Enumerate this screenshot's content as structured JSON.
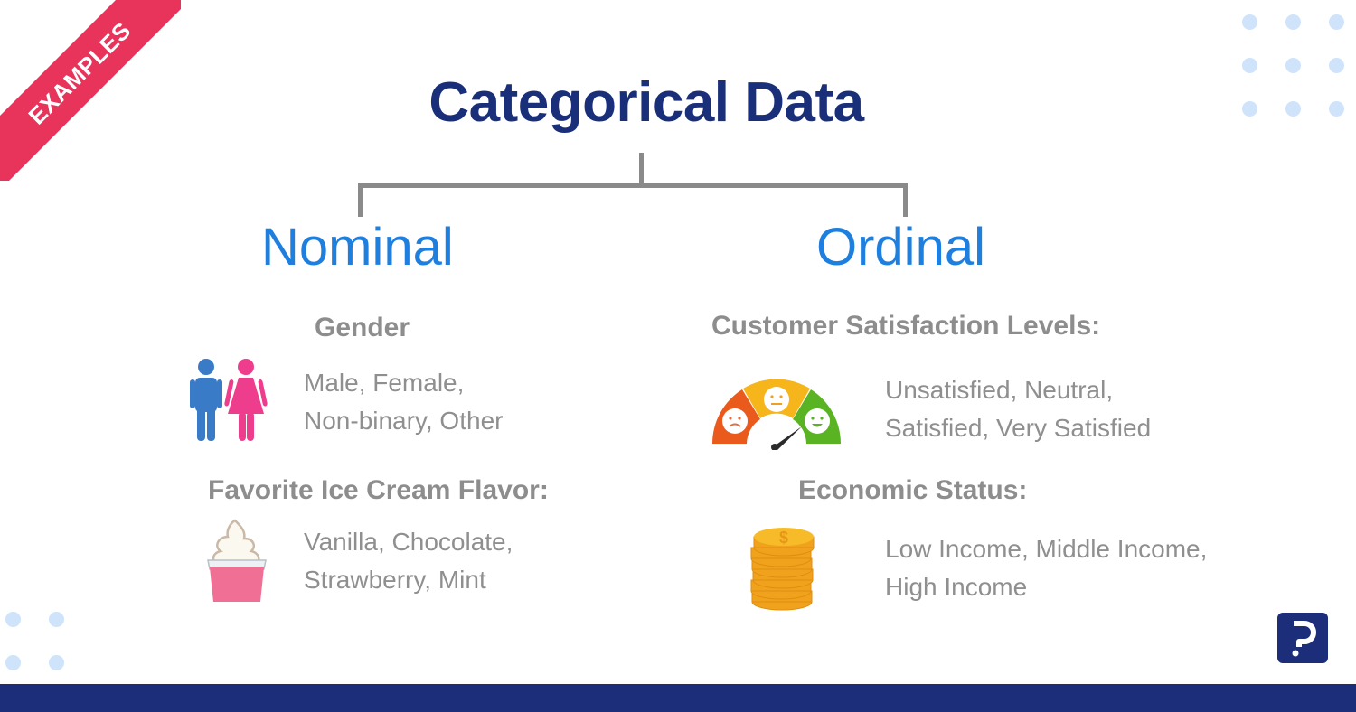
{
  "ribbon": {
    "label": "EXAMPLES",
    "color": "#e8335a"
  },
  "title": "Categorical Data",
  "branches": [
    {
      "label": "Nominal",
      "examples": [
        {
          "heading": "Gender",
          "icon": "male-female-icon",
          "values": [
            "Male, Female,",
            "Non-binary, Other"
          ]
        },
        {
          "heading": "Favorite Ice Cream Flavor:",
          "icon": "ice-cream-icon",
          "values": [
            "Vanilla, Chocolate,",
            "Strawberry, Mint"
          ]
        }
      ]
    },
    {
      "label": "Ordinal",
      "examples": [
        {
          "heading": "Customer Satisfaction Levels:",
          "icon": "satisfaction-gauge-icon",
          "values": [
            "Unsatisfied, Neutral,",
            "Satisfied, Very Satisfied"
          ]
        },
        {
          "heading": "Economic Status:",
          "icon": "coin-stack-icon",
          "values": [
            "Low Income, Middle Income,",
            "High Income"
          ]
        }
      ]
    }
  ],
  "colors": {
    "title": "#1a2f7a",
    "branch": "#1f7fde",
    "text": "#8f8f8f",
    "footer": "#1c2d7a",
    "dots": "#cfe3fb"
  },
  "logo": {
    "icon": "brand-logo-icon"
  }
}
